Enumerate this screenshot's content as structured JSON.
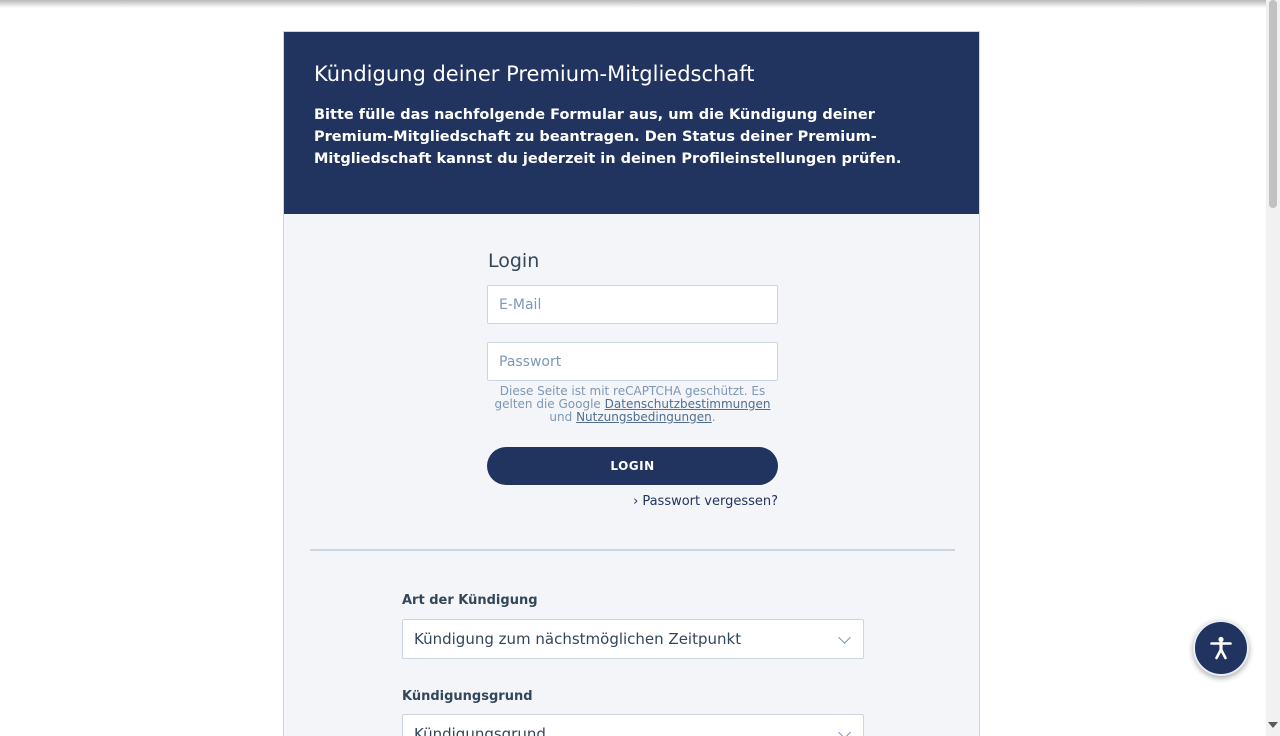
{
  "hero": {
    "title": "Kündigung deiner Premium-Mitgliedschaft",
    "description": "Bitte fülle das nachfolgende Formular aus, um die Kündigung deiner Premium-Mitgliedschaft zu beantragen. Den Status deiner Premium-Mitgliedschaft kannst du jederzeit in deinen Profileinstellungen prüfen."
  },
  "login": {
    "title": "Login",
    "email_placeholder": "E-Mail",
    "password_placeholder": "Passwort",
    "recaptcha_text_1": "Diese Seite ist mit reCAPTCHA geschützt. Es gelten die Google",
    "recaptcha_privacy_link": "Datenschutzbestimmungen",
    "recaptcha_text_2": "und",
    "recaptcha_terms_link": "Nutzungsbedingungen",
    "recaptcha_text_3": ".",
    "button_label": "LOGIN",
    "forgot_password": "Passwort vergessen?"
  },
  "form": {
    "cancellation_type_label": "Art der Kündigung",
    "cancellation_type_value": "Kündigung zum nächstmöglichen Zeitpunkt",
    "cancellation_reason_label": "Kündigungsgrund",
    "cancellation_reason_value": "Kündigungsgrund"
  },
  "colors": {
    "brand": "#213460",
    "card_background": "#f3f5f9",
    "border": "#cbd6e2"
  },
  "icons": {
    "accessibility": "accessibility-icon",
    "forgot_chevron": "chevron-right-icon",
    "select_chevron": "chevron-down-icon"
  }
}
